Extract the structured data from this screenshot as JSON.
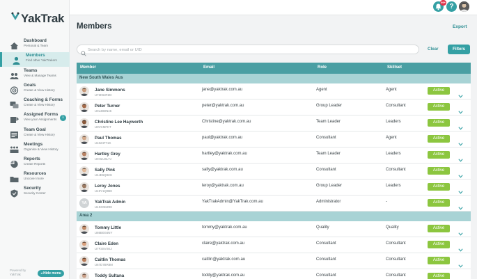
{
  "app": {
    "logo_text": "YakTrak"
  },
  "topbar": {
    "notification_count": "99+",
    "help_label": "?"
  },
  "sidebar": {
    "items": [
      {
        "label": "Dashboard",
        "sub": "Personal & Team",
        "icon": "dashboard-icon"
      },
      {
        "label": "Members",
        "sub": "Find other YakTrakers",
        "icon": "members-icon",
        "active": true
      },
      {
        "label": "Teams",
        "sub": "View & Manage Teams",
        "icon": "teams-icon"
      },
      {
        "label": "Goals",
        "sub": "Create & View History",
        "icon": "goals-icon"
      },
      {
        "label": "Coaching & Forms",
        "sub": "Create & View History",
        "icon": "coaching-icon"
      },
      {
        "label": "Assigned Forms",
        "sub": "View your Assignments",
        "icon": "assigned-forms-icon",
        "badge": "1"
      },
      {
        "label": "Team Goal",
        "sub": "Create & View History",
        "icon": "team-goal-icon"
      },
      {
        "label": "Meetings",
        "sub": "Organise & View History",
        "icon": "meetings-icon"
      },
      {
        "label": "Reports",
        "sub": "Create Reports",
        "icon": "reports-icon"
      },
      {
        "label": "Resources",
        "sub": "Uncover more",
        "icon": "resources-icon"
      },
      {
        "label": "Security",
        "sub": "Security Center",
        "icon": "security-icon"
      }
    ],
    "powered_line1": "Powered by",
    "powered_line2": "YakTrak",
    "hide_menu_label": "Hide menu"
  },
  "main": {
    "title": "Members",
    "export_label": "Export",
    "search_placeholder": "Search by name, email or UID",
    "clear_label": "Clear",
    "filters_label": "Filters"
  },
  "table": {
    "columns": {
      "member": "Member",
      "email": "Email",
      "role": "Role",
      "skillset": "Skillset"
    },
    "groups": [
      {
        "name": "New South Wales Aus",
        "rows": [
          {
            "name": "Jane Simmons",
            "uid": "U73K53FZD",
            "email": "jane@yaktrak.com.au",
            "role": "Agent",
            "skillset": "Agent",
            "status": "Active"
          },
          {
            "name": "Peter Turner",
            "uid": "U0L38DN46",
            "email": "peter@yaktrak.com.au",
            "role": "Group Leader",
            "skillset": "Consultant",
            "status": "Active"
          },
          {
            "name": "Christine Lee Hayworth",
            "uid": "U0VCMFKT",
            "email": "Christine@yaktrak.com.au",
            "role": "Team Leader",
            "skillset": "Leaders",
            "status": "Active"
          },
          {
            "name": "Paul Thomas",
            "uid": "U1024F71K",
            "email": "paul@yaktrak.com.au",
            "role": "Consultant",
            "skillset": "Agent",
            "status": "Active"
          },
          {
            "name": "Hartley Grey",
            "uid": "U0HLU6L7J",
            "email": "hartley@yaktrak.com.au",
            "role": "Team Leader",
            "skillset": "Leaders",
            "status": "Active"
          },
          {
            "name": "Sally Pink",
            "uid": "U4JE6Q83G",
            "email": "sally@yaktrak.com.au",
            "role": "Consultant",
            "skillset": "Consultant",
            "status": "Active"
          },
          {
            "name": "Leroy Jones",
            "uid": "U19Y1Q0B8",
            "email": "leroy@yaktrak.com.au",
            "role": "Group Leader",
            "skillset": "Leaders",
            "status": "Active"
          },
          {
            "name": "YakTrak Admin",
            "uid": "U1K0XDZ08",
            "email": "YakTrakAdmin@YakTrak.com.au",
            "role": "Administrator",
            "skillset": "-",
            "status": "Active",
            "initials": "YA"
          }
        ]
      },
      {
        "name": "Area 2",
        "rows": [
          {
            "name": "Tommy Little",
            "uid": "U86B0G6NY",
            "email": "tommy@yaktrak.com.au",
            "role": "Quality",
            "skillset": "Quality",
            "status": "Active"
          },
          {
            "name": "Claire Eden",
            "uid": "U7F3SVSKJ",
            "email": "claire@yaktrak.com.au",
            "role": "Consultant",
            "skillset": "Consultant",
            "status": "Active"
          },
          {
            "name": "Caitlin Thomas",
            "uid": "U67D7BR8M",
            "email": "caitlin@yaktrak.com.au",
            "role": "Consultant",
            "skillset": "Consultant",
            "status": "Active"
          },
          {
            "name": "Toddy Sultana",
            "uid": "",
            "email": "toddy@yaktrak.com.au",
            "role": "Consultant",
            "skillset": "Consultant",
            "status": "Active"
          }
        ]
      }
    ]
  },
  "colors": {
    "accent": "#34a0a4",
    "active_green": "#8cc63f",
    "group_bg": "#a8d3d5",
    "header_bg": "#4a9fa3"
  }
}
